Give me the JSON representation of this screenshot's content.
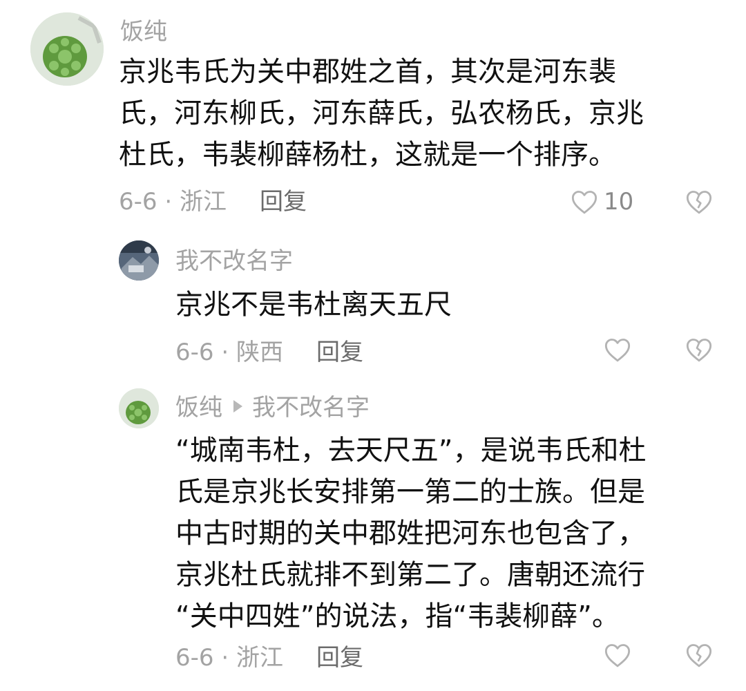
{
  "comments": [
    {
      "username": "饭纯",
      "text_lines": [
        "京兆韦氏为关中郡姓之首，其次是河东裴",
        "氏，河东柳氏，河东薛氏，弘农杨氏，京兆",
        "杜氏，韦裴柳薛杨杜，这就是一个排序。"
      ],
      "date_location": "6-6 · 浙江",
      "reply_label": "回复",
      "like_count": "10",
      "avatar_icon": "turtle-avatar"
    },
    {
      "username": "我不改名字",
      "text_lines": [
        "京兆不是韦杜离天五尺"
      ],
      "date_location": "6-6 · 陕西",
      "reply_label": "回复",
      "avatar_icon": "photo-avatar"
    },
    {
      "username": "饭纯",
      "reply_to": "我不改名字",
      "text_lines": [
        "“城南韦杜，去天尺五”，是说韦氏和杜",
        "氏是京兆长安排第一第二的士族。但是",
        "中古时期的关中郡姓把河东也包含了，",
        "京兆杜氏就排不到第二了。唐朝还流行",
        "“关中四姓”的说法，指“韦裴柳薛”。"
      ],
      "date_location": "6-6 · 浙江",
      "reply_label": "回复",
      "avatar_icon": "turtle-avatar"
    }
  ],
  "colors": {
    "text": "#111111",
    "meta": "#a3a3a3",
    "reply": "#6b6b6b",
    "icon": "#b3b3b3"
  }
}
